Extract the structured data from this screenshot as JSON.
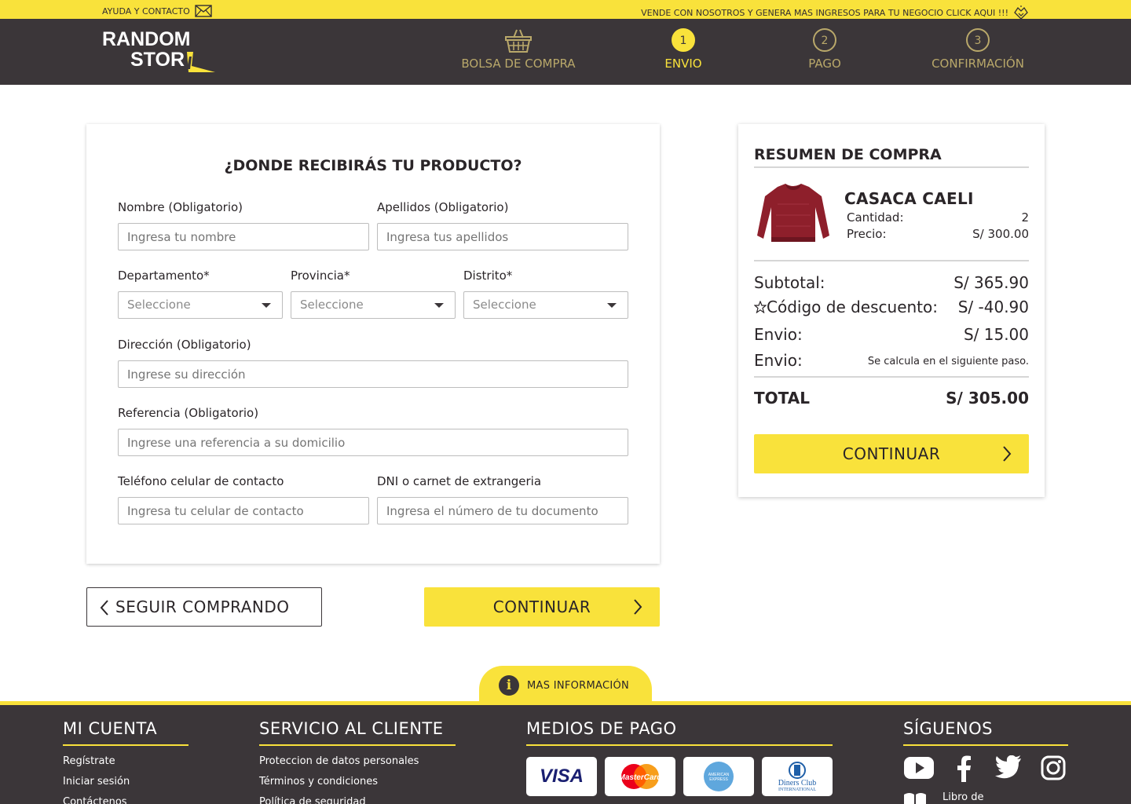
{
  "topbar": {
    "help_label": "AYUDA Y CONTACTO",
    "promo_label": "VENDE CON NOSOTROS Y  GENERA MAS INGRESOS PARA TU NEGOCIO CLICK AQUI !!!"
  },
  "header": {
    "logo_line1": "RANDOM",
    "logo_line2": "STOR",
    "steps": [
      {
        "label": "BOLSA DE COMPRA",
        "num": ""
      },
      {
        "label": "ENVIO",
        "num": "1"
      },
      {
        "label": "PAGO",
        "num": "2"
      },
      {
        "label": "CONFIRMACIÓN",
        "num": "3"
      }
    ],
    "active_step": 1
  },
  "form": {
    "title": "¿DONDE RECIBIRÁS TU PRODUCTO?",
    "nombre_label": "Nombre (Obligatorio)",
    "nombre_placeholder": "Ingresa tu nombre",
    "apellidos_label": "Apellidos (Obligatorio)",
    "apellidos_placeholder": "Ingresa tus apellidos",
    "departamento_label": "Departamento*",
    "provincia_label": "Provincia*",
    "distrito_label": "Distrito*",
    "select_value": "Seleccione",
    "direccion_label": "Dirección (Obligatorio)",
    "direccion_placeholder": "Ingrese su dirección",
    "referencia_label": "Referencia (Obligatorio)",
    "referencia_placeholder": "Ingrese una referencia a su domicilio",
    "telefono_label": "Teléfono celular de contacto",
    "telefono_placeholder": "Ingresa tu celular de contacto",
    "dni_label": "DNI o carnet de extrangeria",
    "dni_placeholder": "Ingresa el número de tu documento"
  },
  "actions": {
    "back_label": "SEGUIR COMPRANDO",
    "continue_label": "CONTINUAR"
  },
  "summary": {
    "title": "RESUMEN DE COMPRA",
    "product_name": "CASACA CAELI",
    "cantidad_label": "Cantidad:",
    "cantidad_value": "2",
    "precio_label": "Precio:",
    "precio_value": "S/ 300.00",
    "subtotal_label": "Subtotal:",
    "subtotal_value": "S/  365.90",
    "descuento_label": "Código de descuento:",
    "descuento_value": "S/ -40.90",
    "envio_label": "Envio:",
    "envio_value": "S/  15.00",
    "envio2_label": "Envio:",
    "envio2_value": "Se calcula en el siguiente paso.",
    "total_label": "TOTAL",
    "total_value": "S/  305.00",
    "continue_label": "CONTINUAR"
  },
  "footer": {
    "info_label": "MAS INFORMACIÓN",
    "mi_cuenta": {
      "title": "MI CUENTA",
      "links": [
        "Regístrate",
        "Iniciar sesión",
        "Contáctenos"
      ]
    },
    "servicio": {
      "title": "SERVICIO AL CLIENTE",
      "links": [
        "Proteccion de datos personales",
        "Términos y condiciones",
        "Política de seguridad"
      ]
    },
    "medios": {
      "title": "MEDIOS DE PAGO",
      "cards": [
        "VISA",
        "MasterCard",
        "AMERICAN EXPRESS",
        "Diners Club INTERNATIONAL"
      ]
    },
    "siguenos": {
      "title": "SÍGUENOS",
      "icons": [
        "youtube-icon",
        "facebook-icon",
        "twitter-icon",
        "instagram-icon"
      ],
      "book_label": "Libro de"
    }
  },
  "colors": {
    "accent": "#f9e23b",
    "dark": "#3b3639",
    "inactive_step": "#b9a86a"
  }
}
